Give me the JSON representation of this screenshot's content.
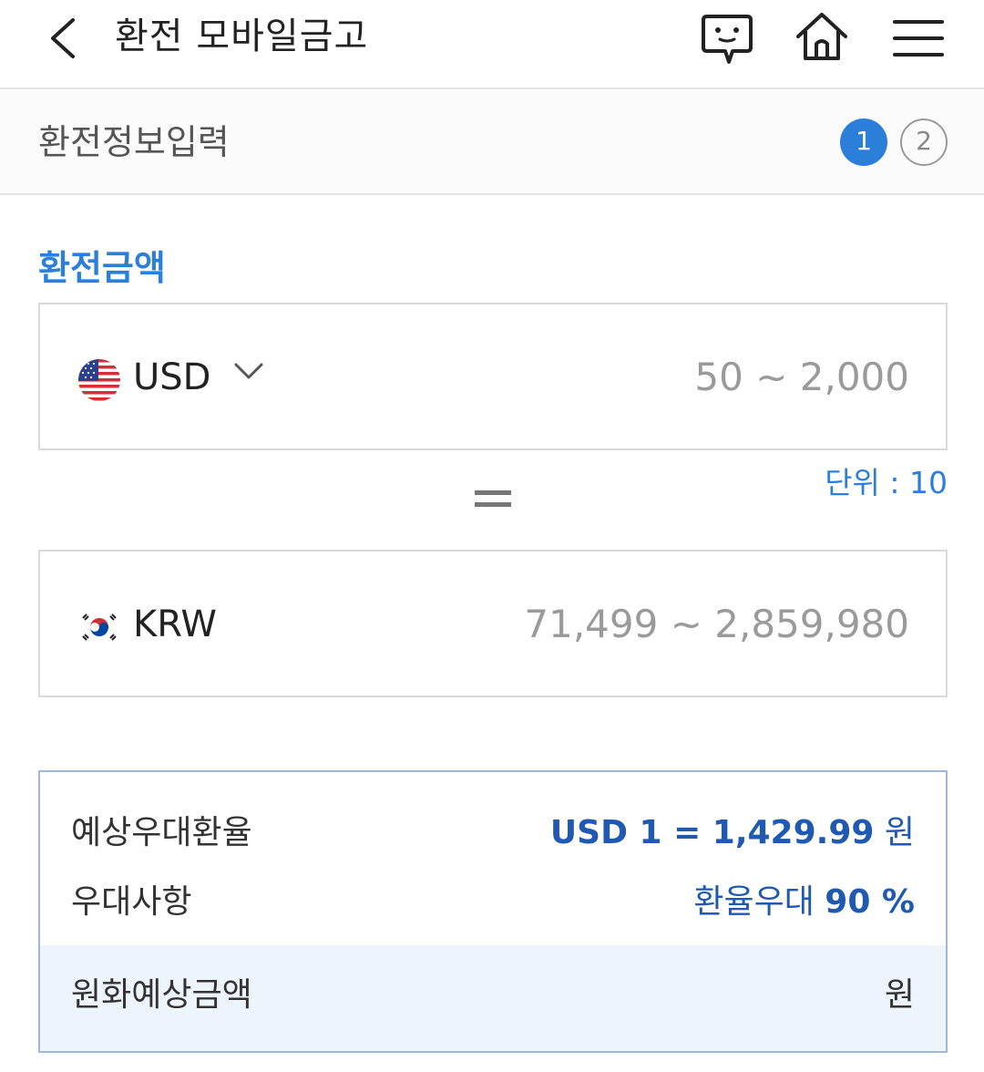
{
  "header": {
    "title": "환전 모바일금고",
    "icons": [
      "back-icon",
      "chat-icon",
      "home-icon",
      "menu-icon"
    ]
  },
  "step": {
    "title": "환전정보입력",
    "steps": [
      "1",
      "2"
    ],
    "current": 1
  },
  "amount": {
    "section_label": "환전금액",
    "from": {
      "code": "USD",
      "range_placeholder": "50 ~ 2,000",
      "flag": "us-flag-icon"
    },
    "unit_note": "단위 : 10",
    "to": {
      "code": "KRW",
      "range_placeholder": "71,499 ~ 2,859,980",
      "flag": "kr-flag-icon"
    }
  },
  "info": {
    "rate_label": "예상우대환율",
    "rate_value": "USD 1 = 1,429.99",
    "rate_unit": "원",
    "benefit_label": "우대사항",
    "benefit_prefix": "환율우대",
    "benefit_value": "90 %",
    "total_label": "원화예상금액",
    "total_unit": "원"
  },
  "colors": {
    "accent": "#2b7fd8",
    "value_blue": "#1f5ab0",
    "total_bg": "#eef4fc",
    "info_border": "#9fb7d8"
  }
}
